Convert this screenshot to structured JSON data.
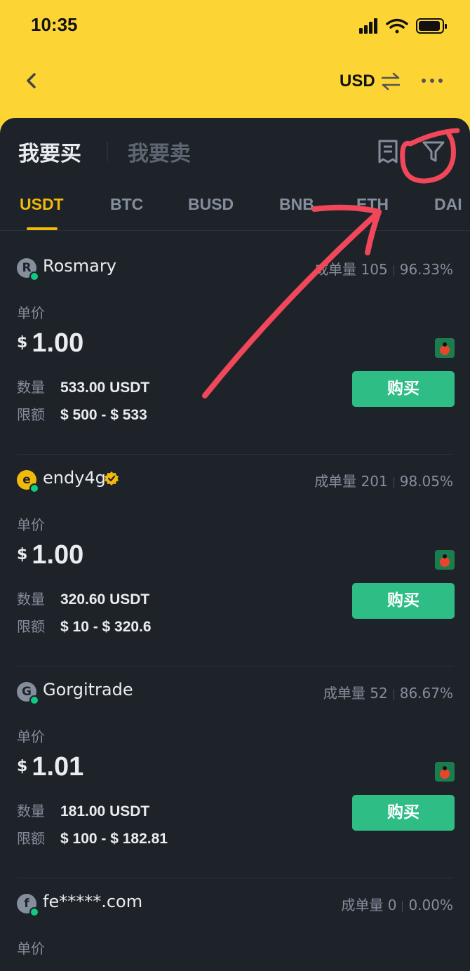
{
  "status_bar": {
    "time": "10:35"
  },
  "header": {
    "currency": "USD"
  },
  "trade_tabs": {
    "buy": "我要买",
    "sell": "我要卖"
  },
  "coins": [
    "USDT",
    "BTC",
    "BUSD",
    "BNB",
    "ETH",
    "DAI"
  ],
  "labels": {
    "unit_price": "单价",
    "quantity": "数量",
    "limit": "限额",
    "buy_button": "购买",
    "orders_prefix": "成单量",
    "currency_symbol": "$"
  },
  "ads": [
    {
      "initial": "R",
      "name": "Rosmary",
      "verified": false,
      "orders": "105",
      "completion": "96.33%",
      "price": "1.00",
      "quantity": "533.00 USDT",
      "limit": "$ 500 - $ 533"
    },
    {
      "initial": "e",
      "name": "endy4g",
      "verified": true,
      "orders": "201",
      "completion": "98.05%",
      "price": "1.00",
      "quantity": "320.60 USDT",
      "limit": "$ 10 - $ 320.6"
    },
    {
      "initial": "G",
      "name": "Gorgitrade",
      "verified": false,
      "orders": "52",
      "completion": "86.67%",
      "price": "1.01",
      "quantity": "181.00 USDT",
      "limit": "$ 100 - $ 182.81"
    },
    {
      "initial": "f",
      "name": "fe*****.com",
      "verified": false,
      "orders": "0",
      "completion": "0.00%"
    }
  ],
  "colors": {
    "brand_yellow": "#fcd535",
    "accent": "#f0b90b",
    "buy_green": "#2ebd85",
    "panel_bg": "#1e2329",
    "annotation_red": "#f0475a"
  },
  "icons": {
    "back": "chevron-left-icon",
    "swap": "swap-arrows-icon",
    "more": "more-dots-icon",
    "orders": "orders-document-icon",
    "filter": "filter-funnel-icon",
    "verified": "verified-badge-icon",
    "payment": "payment-method-icon"
  }
}
